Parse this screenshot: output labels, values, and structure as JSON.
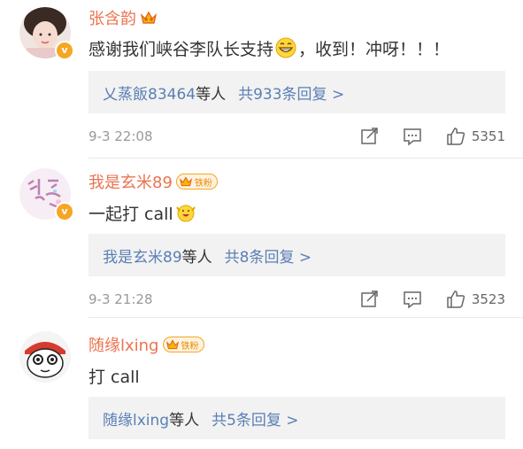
{
  "comments": [
    {
      "user": "张含韵",
      "text": "感谢我们峡谷李队长支持",
      "text_after": "，收到！冲呀！！！",
      "emoji_icon": "grin-emoji",
      "has_fan_badge": false,
      "replies_users": "乂蒸飯83464",
      "replies_middle": "等人",
      "replies_total": "共933条回复 >",
      "time": "9-3 22:08",
      "likes": "5351"
    },
    {
      "user": "我是玄米89",
      "text": "一起打 call",
      "emoji_icon": "cheer-emoji",
      "fan_badge_label": "铁粉",
      "replies_users": "我是玄米89",
      "replies_middle": "等人",
      "replies_total": "共8条回复 >",
      "time": "9-3 21:28",
      "likes": "3523"
    },
    {
      "user": "随缘lxing",
      "text": "打 call",
      "fan_badge_label": "铁粉",
      "replies_users": "随缘lxing",
      "replies_middle": "等人",
      "replies_total": "共5条回复 >"
    }
  ],
  "icons": {
    "crown": "crown-icon",
    "verified": "verified-badge-icon",
    "repost": "repost-icon",
    "comment": "comment-icon",
    "like": "like-icon"
  },
  "colors": {
    "username": "#eb7350",
    "link": "#5a7fb5",
    "verified": "#f5a623",
    "reply_bg": "#f2f2f2"
  }
}
